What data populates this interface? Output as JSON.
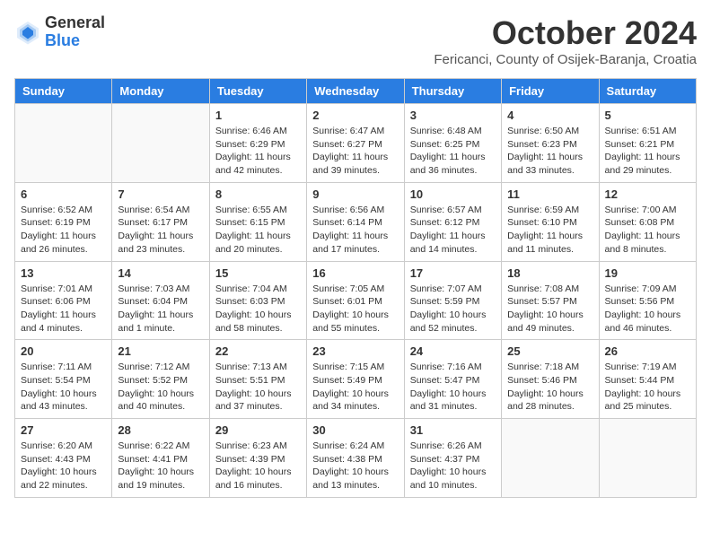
{
  "header": {
    "logo_general": "General",
    "logo_blue": "Blue",
    "month_title": "October 2024",
    "location": "Fericanci, County of Osijek-Baranja, Croatia"
  },
  "days_of_week": [
    "Sunday",
    "Monday",
    "Tuesday",
    "Wednesday",
    "Thursday",
    "Friday",
    "Saturday"
  ],
  "weeks": [
    [
      {
        "day": "",
        "info": ""
      },
      {
        "day": "",
        "info": ""
      },
      {
        "day": "1",
        "info": "Sunrise: 6:46 AM\nSunset: 6:29 PM\nDaylight: 11 hours and 42 minutes."
      },
      {
        "day": "2",
        "info": "Sunrise: 6:47 AM\nSunset: 6:27 PM\nDaylight: 11 hours and 39 minutes."
      },
      {
        "day": "3",
        "info": "Sunrise: 6:48 AM\nSunset: 6:25 PM\nDaylight: 11 hours and 36 minutes."
      },
      {
        "day": "4",
        "info": "Sunrise: 6:50 AM\nSunset: 6:23 PM\nDaylight: 11 hours and 33 minutes."
      },
      {
        "day": "5",
        "info": "Sunrise: 6:51 AM\nSunset: 6:21 PM\nDaylight: 11 hours and 29 minutes."
      }
    ],
    [
      {
        "day": "6",
        "info": "Sunrise: 6:52 AM\nSunset: 6:19 PM\nDaylight: 11 hours and 26 minutes."
      },
      {
        "day": "7",
        "info": "Sunrise: 6:54 AM\nSunset: 6:17 PM\nDaylight: 11 hours and 23 minutes."
      },
      {
        "day": "8",
        "info": "Sunrise: 6:55 AM\nSunset: 6:15 PM\nDaylight: 11 hours and 20 minutes."
      },
      {
        "day": "9",
        "info": "Sunrise: 6:56 AM\nSunset: 6:14 PM\nDaylight: 11 hours and 17 minutes."
      },
      {
        "day": "10",
        "info": "Sunrise: 6:57 AM\nSunset: 6:12 PM\nDaylight: 11 hours and 14 minutes."
      },
      {
        "day": "11",
        "info": "Sunrise: 6:59 AM\nSunset: 6:10 PM\nDaylight: 11 hours and 11 minutes."
      },
      {
        "day": "12",
        "info": "Sunrise: 7:00 AM\nSunset: 6:08 PM\nDaylight: 11 hours and 8 minutes."
      }
    ],
    [
      {
        "day": "13",
        "info": "Sunrise: 7:01 AM\nSunset: 6:06 PM\nDaylight: 11 hours and 4 minutes."
      },
      {
        "day": "14",
        "info": "Sunrise: 7:03 AM\nSunset: 6:04 PM\nDaylight: 11 hours and 1 minute."
      },
      {
        "day": "15",
        "info": "Sunrise: 7:04 AM\nSunset: 6:03 PM\nDaylight: 10 hours and 58 minutes."
      },
      {
        "day": "16",
        "info": "Sunrise: 7:05 AM\nSunset: 6:01 PM\nDaylight: 10 hours and 55 minutes."
      },
      {
        "day": "17",
        "info": "Sunrise: 7:07 AM\nSunset: 5:59 PM\nDaylight: 10 hours and 52 minutes."
      },
      {
        "day": "18",
        "info": "Sunrise: 7:08 AM\nSunset: 5:57 PM\nDaylight: 10 hours and 49 minutes."
      },
      {
        "day": "19",
        "info": "Sunrise: 7:09 AM\nSunset: 5:56 PM\nDaylight: 10 hours and 46 minutes."
      }
    ],
    [
      {
        "day": "20",
        "info": "Sunrise: 7:11 AM\nSunset: 5:54 PM\nDaylight: 10 hours and 43 minutes."
      },
      {
        "day": "21",
        "info": "Sunrise: 7:12 AM\nSunset: 5:52 PM\nDaylight: 10 hours and 40 minutes."
      },
      {
        "day": "22",
        "info": "Sunrise: 7:13 AM\nSunset: 5:51 PM\nDaylight: 10 hours and 37 minutes."
      },
      {
        "day": "23",
        "info": "Sunrise: 7:15 AM\nSunset: 5:49 PM\nDaylight: 10 hours and 34 minutes."
      },
      {
        "day": "24",
        "info": "Sunrise: 7:16 AM\nSunset: 5:47 PM\nDaylight: 10 hours and 31 minutes."
      },
      {
        "day": "25",
        "info": "Sunrise: 7:18 AM\nSunset: 5:46 PM\nDaylight: 10 hours and 28 minutes."
      },
      {
        "day": "26",
        "info": "Sunrise: 7:19 AM\nSunset: 5:44 PM\nDaylight: 10 hours and 25 minutes."
      }
    ],
    [
      {
        "day": "27",
        "info": "Sunrise: 6:20 AM\nSunset: 4:43 PM\nDaylight: 10 hours and 22 minutes."
      },
      {
        "day": "28",
        "info": "Sunrise: 6:22 AM\nSunset: 4:41 PM\nDaylight: 10 hours and 19 minutes."
      },
      {
        "day": "29",
        "info": "Sunrise: 6:23 AM\nSunset: 4:39 PM\nDaylight: 10 hours and 16 minutes."
      },
      {
        "day": "30",
        "info": "Sunrise: 6:24 AM\nSunset: 4:38 PM\nDaylight: 10 hours and 13 minutes."
      },
      {
        "day": "31",
        "info": "Sunrise: 6:26 AM\nSunset: 4:37 PM\nDaylight: 10 hours and 10 minutes."
      },
      {
        "day": "",
        "info": ""
      },
      {
        "day": "",
        "info": ""
      }
    ]
  ]
}
